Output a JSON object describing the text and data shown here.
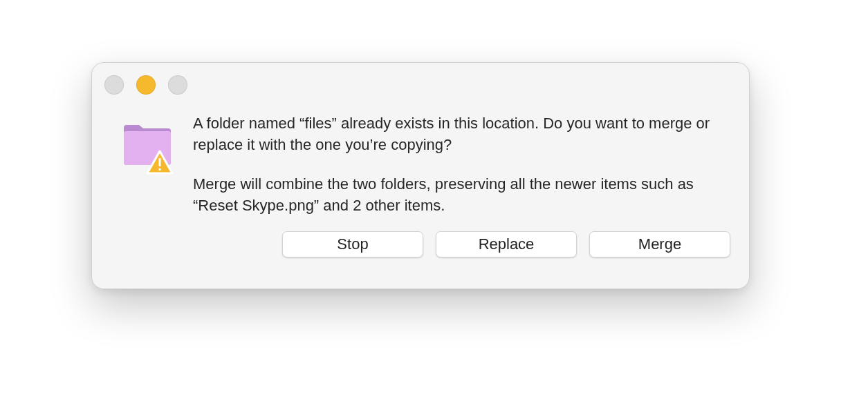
{
  "window": {
    "controls": [
      {
        "color": "#dcdcdc"
      },
      {
        "color": "#f6b92d"
      },
      {
        "color": "#dcdcdc"
      }
    ]
  },
  "message": [
    "A folder named “files” already exists in this location. Do you want to merge or replace it with the one you’re copying?",
    "Merge will combine the two folders, preserving all the newer items such as “Reset Skype.png” and 2 other items."
  ],
  "buttons": [
    "Stop",
    "Replace",
    "Merge"
  ]
}
